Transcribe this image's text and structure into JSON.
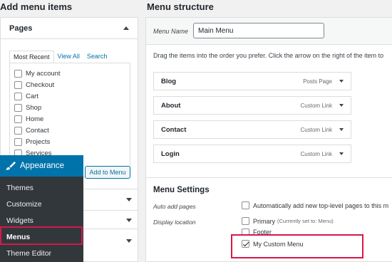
{
  "left": {
    "heading": "Add menu items",
    "pages_panel": {
      "title": "Pages",
      "tabs": [
        "Most Recent",
        "View All",
        "Search"
      ],
      "items": [
        "My account",
        "Checkout",
        "Cart",
        "Shop",
        "Home",
        "Contact",
        "Projects",
        "Services"
      ],
      "add_button": "Add to Menu"
    }
  },
  "admin_menu": {
    "header": "Appearance",
    "items": [
      "Themes",
      "Customize",
      "Widgets",
      "Menus",
      "Theme Editor"
    ]
  },
  "right": {
    "heading": "Menu structure",
    "menu_name_label": "Menu Name",
    "menu_name_value": "Main Menu",
    "instructions": "Drag the items into the order you prefer. Click the arrow on the right of the item to",
    "items": [
      {
        "title": "Blog",
        "type": "Posts Page"
      },
      {
        "title": "About",
        "type": "Custom Link"
      },
      {
        "title": "Contact",
        "type": "Custom Link"
      },
      {
        "title": "Login",
        "type": "Custom Link"
      }
    ],
    "settings": {
      "heading": "Menu Settings",
      "auto_add_label": "Auto add pages",
      "auto_add_text": "Automatically add new top-level pages to this m",
      "display_location_label": "Display location",
      "locations": [
        {
          "label": "Primary",
          "note": "(Currently set to: Menu)",
          "checked": false
        },
        {
          "label": "Footer",
          "note": "",
          "checked": false
        },
        {
          "label": "My Custom Menu",
          "note": "",
          "checked": true
        }
      ]
    }
  },
  "colors": {
    "accent": "#0073aa",
    "admin_bg": "#23282d",
    "highlight": "#d6184b"
  }
}
